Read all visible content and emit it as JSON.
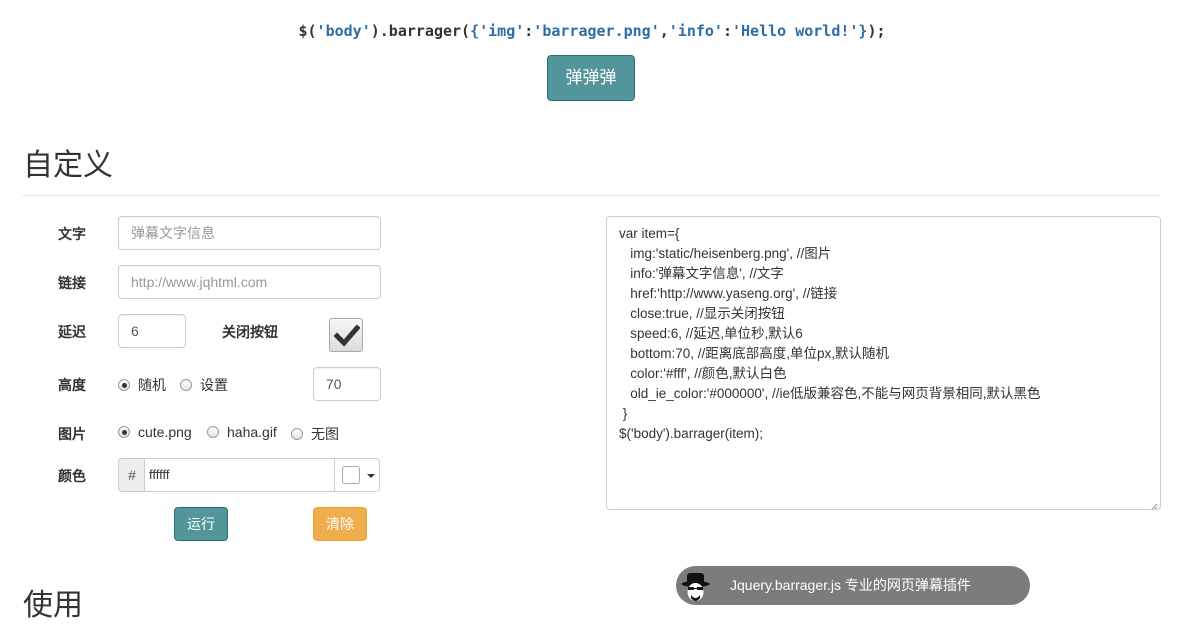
{
  "header": {
    "code_prefix": "$(",
    "code_body_str": "'body'",
    "code_mid": ").barrager(",
    "code_obj_open": "{",
    "code_key1": "'img'",
    "code_colon1": ":",
    "code_val1": "'barrager.png'",
    "code_comma": ",",
    "code_key2": "'info'",
    "code_colon2": ":",
    "code_val2": "'Hello world!'",
    "code_obj_close": "}",
    "code_suffix": ");",
    "fire_button": "弹弹弹"
  },
  "section_custom": {
    "title": "自定义",
    "text_label": "文字",
    "text_placeholder": "弹幕文字信息",
    "link_label": "链接",
    "link_placeholder": "http://www.jqhtml.com",
    "delay_label": "延迟",
    "delay_value": "6",
    "close_label": "关闭按钮",
    "close_checked": true,
    "height_label": "高度",
    "height_options": [
      "随机",
      "设置"
    ],
    "height_selected": "随机",
    "height_value": "70",
    "image_label": "图片",
    "image_options": [
      "cute.png",
      "haha.gif",
      "无图"
    ],
    "image_selected": "cute.png",
    "color_label": "颜色",
    "color_prefix": "#",
    "color_value": "ffffff",
    "color_swatch": "#ffffff",
    "run_button": "运行",
    "clear_button": "清除"
  },
  "code_sample": {
    "lines": [
      "var item={",
      "   img:'static/heisenberg.png', //图片",
      "   info:'弹幕文字信息', //文字",
      "   href:'http://www.yaseng.org', //链接",
      "   close:true, //显示关闭按钮",
      "   speed:6, //延迟,单位秒,默认6",
      "   bottom:70, //距离底部高度,单位px,默认随机",
      "   color:'#fff', //颜色,默认白色",
      "   old_ie_color:'#000000', //ie低版兼容色,不能与网页背景相同,默认黑色",
      " }",
      "$('body').barrager(item);"
    ]
  },
  "section_use": {
    "title": "使用"
  },
  "barrage": {
    "text": "Jquery.barrager.js 专业的网页弹幕插件",
    "avatar_icon": "heisenberg-avatar-icon"
  },
  "colors": {
    "teal_button": "#52969c",
    "orange_button": "#f0ad4e",
    "barrage_bg": "#7c7c7c",
    "code_string": "#2e6da4"
  }
}
